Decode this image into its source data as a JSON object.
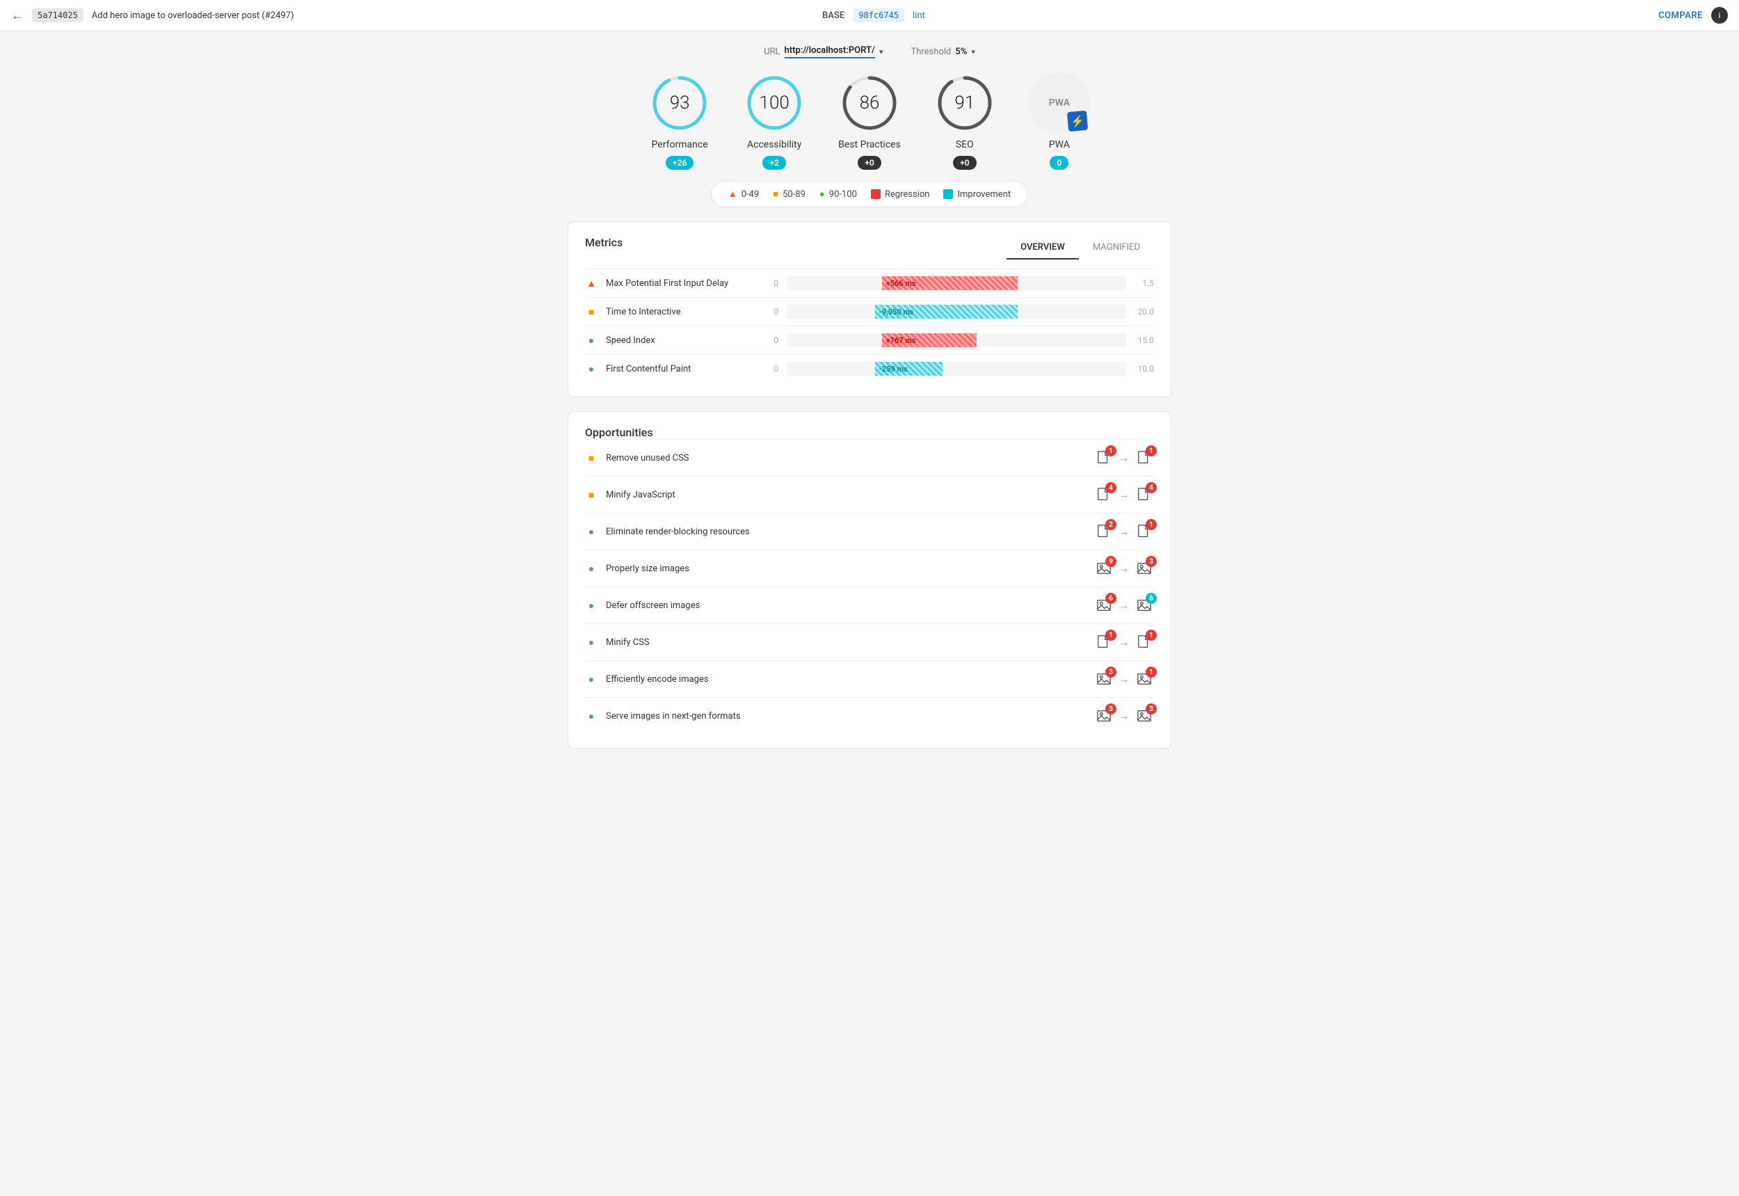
{
  "header": {
    "back_label": "←",
    "commit_base": "5a714025",
    "commit_title": "Add hero image to overloaded-server post (#2497)",
    "base_label": "BASE",
    "commit_compare": "98fc6745",
    "lint_label": "lint",
    "compare_label": "COMPARE",
    "info_label": "i"
  },
  "url_bar": {
    "url_label": "URL",
    "url_value": "http://localhost:PORT/",
    "threshold_label": "Threshold",
    "threshold_value": "5%"
  },
  "scores": [
    {
      "id": "performance",
      "value": "93",
      "label": "Performance",
      "badge": "+26",
      "badge_type": "blue",
      "color": "#4dd0e1",
      "track_color": "#333"
    },
    {
      "id": "accessibility",
      "value": "100",
      "label": "Accessibility",
      "badge": "+2",
      "badge_type": "blue",
      "color": "#4dd0e1",
      "track_color": "#333"
    },
    {
      "id": "best-practices",
      "value": "86",
      "label": "Best Practices",
      "badge": "+0",
      "badge_type": "dark",
      "color": "#333",
      "track_color": "#ddd"
    },
    {
      "id": "seo",
      "value": "91",
      "label": "SEO",
      "badge": "+0",
      "badge_type": "dark",
      "color": "#333",
      "track_color": "#ddd"
    }
  ],
  "pwa": {
    "label": "PWA",
    "badge_value": "0"
  },
  "legend": {
    "items": [
      {
        "id": "range-0-49",
        "icon": "▲",
        "color": "#ff5722",
        "label": "0-49"
      },
      {
        "id": "range-50-89",
        "icon": "■",
        "color": "#ff9800",
        "label": "50-89"
      },
      {
        "id": "range-90-100",
        "icon": "●",
        "color": "#4caf50",
        "label": "90-100"
      },
      {
        "id": "regression",
        "label": "Regression",
        "color": "#e53935"
      },
      {
        "id": "improvement",
        "label": "Improvement",
        "color": "#00bcd4"
      }
    ]
  },
  "metrics": {
    "title": "Metrics",
    "tabs": [
      {
        "id": "overview",
        "label": "OVERVIEW",
        "active": true
      },
      {
        "id": "magnified",
        "label": "MAGNIFIED",
        "active": false
      }
    ],
    "rows": [
      {
        "id": "max-fid",
        "indicator": "▲",
        "indicator_color": "#ff5722",
        "name": "Max Potential First Input Delay",
        "zero": "0",
        "bar_type": "regression",
        "bar_label": "+566 ms",
        "bar_width": "45%",
        "bar_offset": "30%",
        "magnified": "1.5"
      },
      {
        "id": "tti",
        "indicator": "■",
        "indicator_color": "#ff9800",
        "name": "Time to Interactive",
        "zero": "0",
        "bar_type": "improvement",
        "bar_label": "-9,950 ms",
        "bar_width": "42%",
        "bar_offset": "28%",
        "magnified": "20.0"
      },
      {
        "id": "speed-index",
        "indicator": "●",
        "indicator_color": "#4caf50",
        "name": "Speed Index",
        "zero": "0",
        "bar_type": "regression",
        "bar_label": "+767 ms",
        "bar_width": "25%",
        "bar_offset": "30%",
        "magnified": "15.0"
      },
      {
        "id": "fcp",
        "indicator": "●",
        "indicator_color": "#4caf50",
        "name": "First Contentful Paint",
        "zero": "0",
        "bar_type": "improvement",
        "bar_label": "-259 ms",
        "bar_width": "18%",
        "bar_offset": "28%",
        "magnified": "10.0"
      }
    ]
  },
  "opportunities": {
    "title": "Opportunities",
    "rows": [
      {
        "id": "unused-css",
        "indicator": "■",
        "indicator_color": "#ff9800",
        "name": "Remove unused CSS",
        "icon_type": "file",
        "from_badge": "1",
        "from_badge_type": "none",
        "to_badge": "1",
        "to_badge_type": "red"
      },
      {
        "id": "minify-js",
        "indicator": "■",
        "indicator_color": "#ff9800",
        "name": "Minify JavaScript",
        "icon_type": "file",
        "from_badge": "4",
        "from_badge_type": "none",
        "to_badge": "4",
        "to_badge_type": "red"
      },
      {
        "id": "render-blocking",
        "indicator": "●",
        "indicator_color": "#4caf50",
        "name": "Eliminate render-blocking resources",
        "icon_type": "file",
        "from_badge": "2",
        "from_badge_type": "none",
        "to_badge": "1",
        "to_badge_type": "red"
      },
      {
        "id": "properly-size",
        "indicator": "●",
        "indicator_color": "#4caf50",
        "name": "Properly size images",
        "icon_type": "image",
        "from_badge": "9",
        "from_badge_type": "none",
        "to_badge": "3",
        "to_badge_type": "red"
      },
      {
        "id": "defer-offscreen",
        "indicator": "●",
        "indicator_color": "#4caf50",
        "name": "Defer offscreen images",
        "icon_type": "image",
        "from_badge": "6",
        "from_badge_type": "none",
        "to_badge": "6",
        "to_badge_type": "cyan"
      },
      {
        "id": "minify-css",
        "indicator": "●",
        "indicator_color": "#4caf50",
        "name": "Minify CSS",
        "icon_type": "file",
        "from_badge": "1",
        "from_badge_type": "none",
        "to_badge": "1",
        "to_badge_type": "red"
      },
      {
        "id": "encode-images",
        "indicator": "●",
        "indicator_color": "#4caf50",
        "name": "Efficiently encode images",
        "icon_type": "image",
        "from_badge": "3",
        "from_badge_type": "none",
        "to_badge": "1",
        "to_badge_type": "red"
      },
      {
        "id": "nextgen-formats",
        "indicator": "●",
        "indicator_color": "#4caf50",
        "name": "Serve images in next-gen formats",
        "icon_type": "image",
        "from_badge": "3",
        "from_badge_type": "none",
        "to_badge": "3",
        "to_badge_type": "red"
      }
    ]
  }
}
